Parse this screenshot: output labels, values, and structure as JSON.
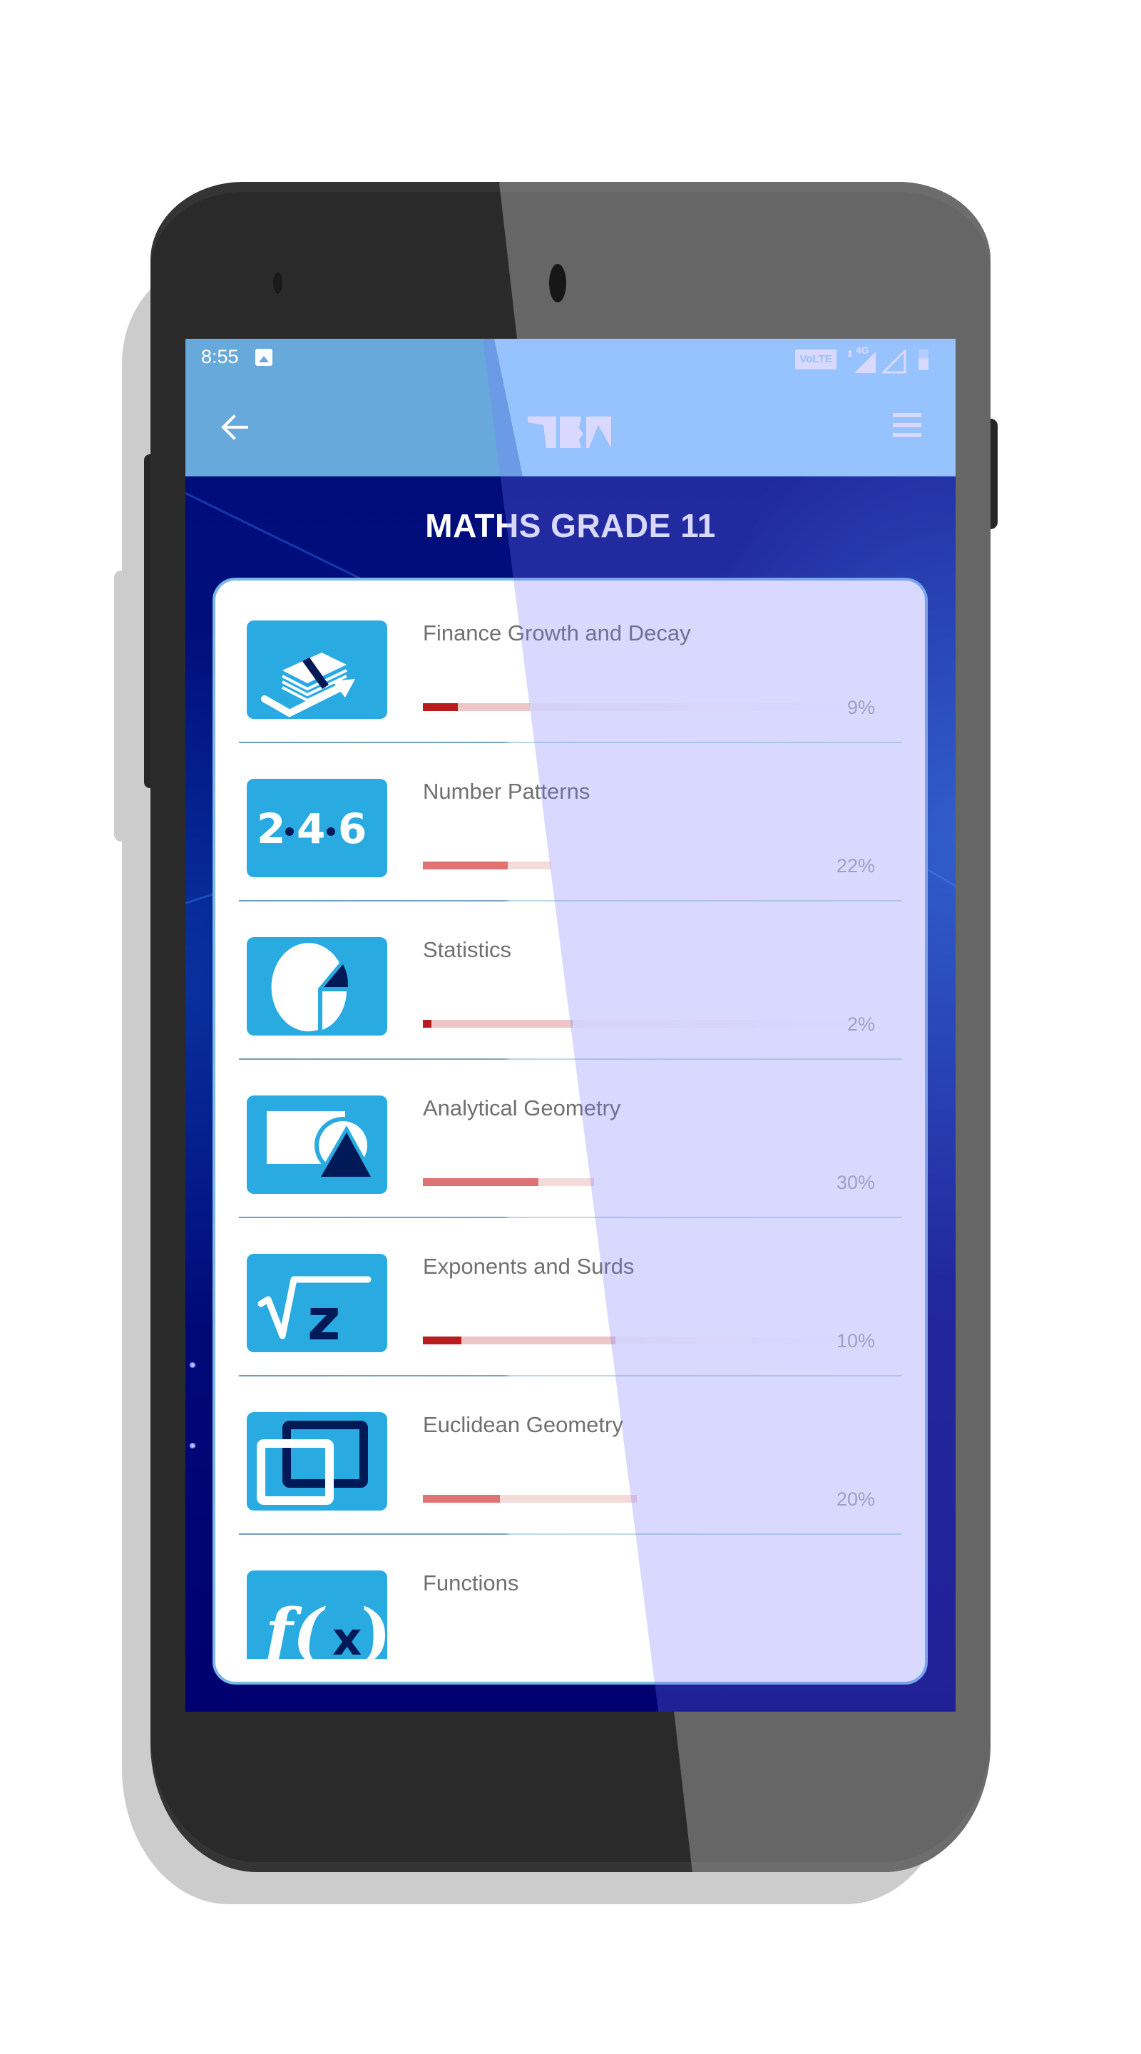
{
  "status_bar": {
    "time": "8:55",
    "notification_icon": "image-icon",
    "volte_label": "VoLTE",
    "network_label": "4G",
    "icons": [
      "volte-icon",
      "data-arrows-icon",
      "signal-4g-icon",
      "signal-empty-icon",
      "battery-icon"
    ]
  },
  "app_bar": {
    "back_icon": "arrow-left-icon",
    "logo_icon": "app-logo-icon",
    "menu_icon": "hamburger-menu-icon"
  },
  "page": {
    "title": "MATHS GRADE 11"
  },
  "topics": [
    {
      "title": "Finance Growth and Decay",
      "percent_label": "9%",
      "progress": 0.09,
      "icon": "money-growth-icon"
    },
    {
      "title": "Number Patterns",
      "percent_label": "22%",
      "progress": 0.22,
      "icon": "number-pattern-icon"
    },
    {
      "title": "Statistics",
      "percent_label": "2%",
      "progress": 0.02,
      "icon": "pie-chart-icon"
    },
    {
      "title": "Analytical Geometry",
      "percent_label": "30%",
      "progress": 0.3,
      "icon": "shapes-icon"
    },
    {
      "title": "Exponents and Surds",
      "percent_label": "10%",
      "progress": 0.1,
      "icon": "square-root-icon"
    },
    {
      "title": "Euclidean Geometry",
      "percent_label": "20%",
      "progress": 0.2,
      "icon": "overlapping-squares-icon"
    },
    {
      "title": "Functions",
      "percent_label": "",
      "progress": null,
      "icon": "function-fx-icon"
    }
  ],
  "colors": {
    "status_bar_dark": "#68a9dc",
    "status_bar_light": "#a2e0fd",
    "background_navy": "#00006e",
    "icon_blue": "#29abe2",
    "icon_navy": "#001a57",
    "progress_fill": "#b81c1c",
    "progress_buffer": "#edc6c8",
    "card_border": "#7ab6e6",
    "text_gray": "#707070",
    "percent_gray": "#b0b0b0"
  }
}
